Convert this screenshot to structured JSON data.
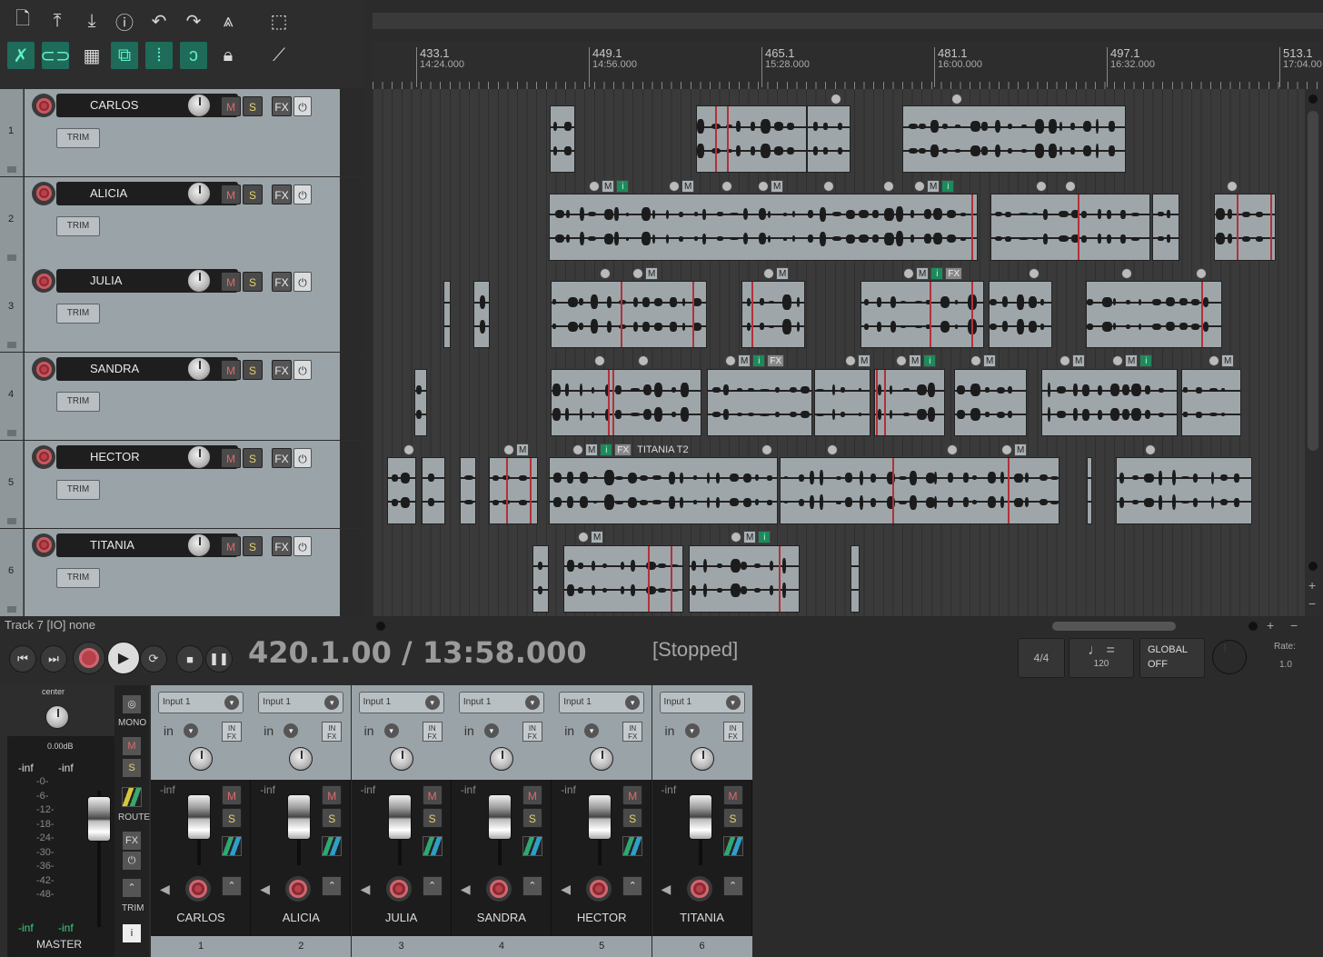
{
  "toolbar": {
    "icons": [
      "new-project-icon",
      "save-icon",
      "import-icon",
      "info-icon",
      "undo-icon",
      "redo-icon",
      "metronome-icon",
      "marquee-icon",
      "ripple-icon",
      "link-icon",
      "grid-icon",
      "group-icon",
      "snap-icon",
      "loop-icon",
      "lock-icon",
      "cursor-icon"
    ]
  },
  "ruler": {
    "marks": [
      {
        "bar": "433.1",
        "time": "14:24.000"
      },
      {
        "bar": "449.1",
        "time": "14:56.000"
      },
      {
        "bar": "465.1",
        "time": "15:28.000"
      },
      {
        "bar": "481.1",
        "time": "16:00.000"
      },
      {
        "bar": "497.1",
        "time": "16:32.000"
      },
      {
        "bar": "513.1",
        "time": "17:04.00"
      }
    ]
  },
  "tracks": [
    {
      "num": "1",
      "name": "CARLOS",
      "trim": "TRIM",
      "m": "M",
      "s": "S",
      "fx": "FX"
    },
    {
      "num": "2",
      "name": "ALICIA",
      "trim": "TRIM",
      "m": "M",
      "s": "S",
      "fx": "FX"
    },
    {
      "num": "3",
      "name": "JULIA",
      "trim": "TRIM",
      "m": "M",
      "s": "S",
      "fx": "FX"
    },
    {
      "num": "4",
      "name": "SANDRA",
      "trim": "TRIM",
      "m": "M",
      "s": "S",
      "fx": "FX"
    },
    {
      "num": "5",
      "name": "HECTOR",
      "trim": "TRIM",
      "m": "M",
      "s": "S",
      "fx": "FX"
    },
    {
      "num": "6",
      "name": "TITANIA",
      "trim": "TRIM",
      "m": "M",
      "s": "S",
      "fx": "FX"
    }
  ],
  "item_label": "TITANIA T2",
  "status_line": "Track 7 [IO] none",
  "transport": {
    "position": "420.1.00 / 13:58.000",
    "state": "[Stopped]",
    "time_sig": "4/4",
    "tempo": "120",
    "global_label": "GLOBAL",
    "global_value": "OFF",
    "rate_label": "Rate:",
    "rate_value": "1.0"
  },
  "master": {
    "pan": "center",
    "mono": "MONO",
    "volume": "0.00dB",
    "inf_l": "-inf",
    "inf_r": "-inf",
    "scale": [
      "-0-",
      "-6-",
      "-12-",
      "-18-",
      "-24-",
      "-30-",
      "-36-",
      "-42-",
      "-48-"
    ],
    "inf_bl": "-inf",
    "inf_br": "-inf",
    "name": "MASTER",
    "route": "ROUTE",
    "trim": "TRIM",
    "fx": "FX",
    "m": "M",
    "s": "S",
    "info": "i"
  },
  "mixer": {
    "channels": [
      {
        "name": "CARLOS",
        "num": "1",
        "input": "Input 1",
        "in": "in",
        "level": "-inf",
        "m": "M",
        "s": "S"
      },
      {
        "name": "ALICIA",
        "num": "2",
        "input": "Input 1",
        "in": "in",
        "level": "-inf",
        "m": "M",
        "s": "S"
      },
      {
        "name": "JULIA",
        "num": "3",
        "input": "Input 1",
        "in": "in",
        "level": "-inf",
        "m": "M",
        "s": "S"
      },
      {
        "name": "SANDRA",
        "num": "4",
        "input": "Input 1",
        "in": "in",
        "level": "-inf",
        "m": "M",
        "s": "S"
      },
      {
        "name": "HECTOR",
        "num": "5",
        "input": "Input 1",
        "in": "in",
        "level": "-inf",
        "m": "M",
        "s": "S"
      },
      {
        "name": "TITANIA",
        "num": "6",
        "input": "Input 1",
        "in": "in",
        "level": "-inf",
        "m": "M",
        "s": "S"
      }
    ]
  },
  "colors": {
    "record": "#b7404a",
    "accent": "#5ff0c8",
    "track_panel": "#9aa3a7",
    "item": "#9ea6aa",
    "mute": "#e06a6a",
    "solo": "#e6d36b",
    "fx_tag_i": "#1d8a5c"
  }
}
